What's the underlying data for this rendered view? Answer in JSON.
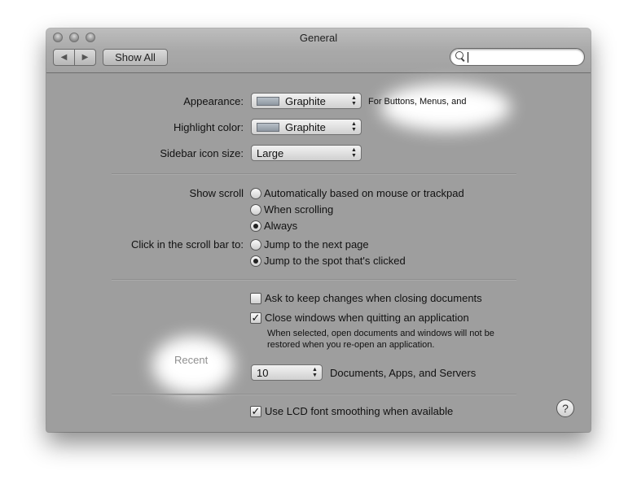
{
  "window": {
    "title": "General"
  },
  "toolbar": {
    "back_icon": "◀",
    "forward_icon": "▶",
    "show_all_label": "Show All"
  },
  "appearance": {
    "label": "Appearance:",
    "value": "Graphite",
    "note": "For Buttons, Menus, and"
  },
  "highlight": {
    "label": "Highlight color:",
    "value": "Graphite"
  },
  "sidebar_icon": {
    "label": "Sidebar icon size:",
    "value": "Large"
  },
  "scroll": {
    "label": "Show scroll",
    "options": [
      "Automatically based on mouse or trackpad",
      "When scrolling",
      "Always"
    ],
    "selected": 2
  },
  "click_scroll": {
    "label": "Click in the scroll bar to:",
    "options": [
      "Jump to the next page",
      "Jump to the spot that's clicked"
    ],
    "selected": 1
  },
  "documents": {
    "ask_keep_label": "Ask to keep changes when closing documents",
    "ask_keep_checked": false,
    "close_windows_label": "Close windows when quitting an application",
    "close_windows_checked": true,
    "close_windows_desc_1": "When selected, open documents and windows will not be",
    "close_windows_desc_2": "restored when you re-open an application."
  },
  "recent": {
    "label": "Recent",
    "value": "10",
    "suffix": "Documents, Apps, and Servers"
  },
  "lcd": {
    "label": "Use LCD font smoothing when available",
    "checked": true
  },
  "help": {
    "icon": "?"
  },
  "colors": {
    "window_bg": "#9e9e9e",
    "graphite_swatch": "#a3abb4"
  }
}
